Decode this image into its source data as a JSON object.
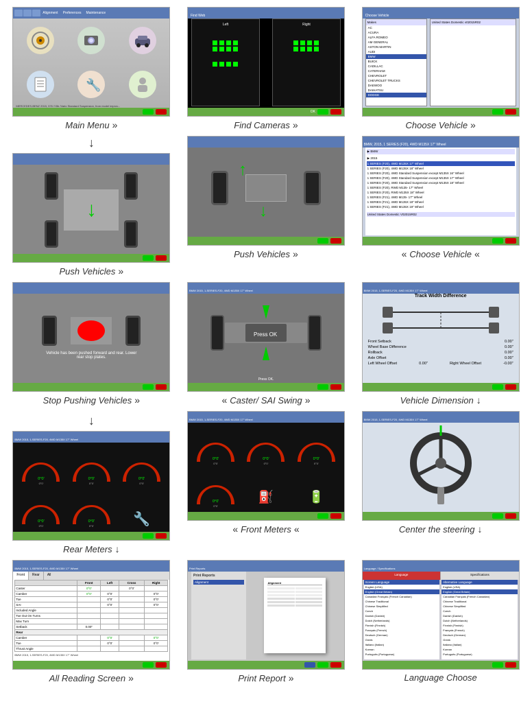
{
  "grid": {
    "cells": [
      {
        "id": "main-menu",
        "label": "Main Menu",
        "arrow": "»",
        "arrowDir": "right"
      },
      {
        "id": "find-cameras",
        "label": "Find Cameras",
        "arrow": "»",
        "arrowDir": "right"
      },
      {
        "id": "choose-vehicle",
        "label": "Choose Vehicle",
        "arrow": "»",
        "arrowDir": "right"
      },
      {
        "id": "push-vehicles-1",
        "label": "Push Vehicles",
        "arrow": "»",
        "arrowDir": "right"
      },
      {
        "id": "push-vehicles-2",
        "label": "Push Vehicles",
        "arrow": "»",
        "arrowDir": "right"
      },
      {
        "id": "choose-vehicle-2",
        "label": "Choose Vehicle",
        "arrow": "«",
        "arrowDir": "left"
      },
      {
        "id": "stop-pushing",
        "label": "Stop Pushing Vehicles",
        "arrow": "»",
        "arrowDir": "right"
      },
      {
        "id": "caster-sai",
        "label": "Caster/ SAI Swing",
        "arrow": "»",
        "arrowDir": "right"
      },
      {
        "id": "vehicle-dimension",
        "label": "Vehicle Dimension",
        "arrow": "↓",
        "arrowDir": "down"
      },
      {
        "id": "rear-meters",
        "label": "Rear Meters",
        "arrow": "↓",
        "arrowDir": "down"
      },
      {
        "id": "front-meters",
        "label": "Front Meters",
        "arrow": "«",
        "arrowDir": "left"
      },
      {
        "id": "center-steering",
        "label": "Center the steering",
        "arrow": "↓",
        "arrowDir": "down"
      },
      {
        "id": "all-reading",
        "label": "All Reading Screen",
        "arrow": "»",
        "arrowDir": "right"
      },
      {
        "id": "print-report",
        "label": "Print Report",
        "arrow": "»",
        "arrowDir": "right"
      },
      {
        "id": "language-choose",
        "label": "Language Choose",
        "arrow": "",
        "arrowDir": "none"
      }
    ],
    "vehicle_list": [
      "AC",
      "ACURA",
      "ALFA ROMEO",
      "AM GENERAL",
      "ASTON MARTIN",
      "AUDI",
      "BMW",
      "BUICK",
      "CADILLAC",
      "CATERHAM",
      "CHEVROLET",
      "CHEVROLET TRUCKS",
      "DAEWOO",
      "DAIHATSU",
      "DODGE"
    ],
    "vehicle_models": [
      "▶ 2015",
      "1 SERIES (F20), 4WD M135X 16\" Wheel",
      "1 SERIES (F20), 4WD M135X 17\" Wheel",
      "1 SERIES (F20), 4WD M135X 18\" Wheel",
      "1 SERIES (F20), 4WD Standard Suspension except M135X 16\" Wheel",
      "1 SERIES (F20), 4WD Standard Suspension except M135X 17\" Wheel",
      "1 SERIES (F20), 4WD Standard Suspension except M135X 18\" Wheel",
      "1 SERIES (F20), RWD M135- 17\" Wheel",
      "1 SERIES (F20), RWD M135X 18\" Wheel",
      "1 SERIES (F21), 4WD M135- 17\" Wheel",
      "1 SERIES (F21), 4WD M135X 18\" Wheel",
      "1 SERIES (F21), 4WD M135X 19\" Wheel"
    ],
    "languages": [
      "English (USA)",
      "English (Great Britain)",
      "Canadian Fraçais (French Canadian)",
      "Chinese Traditional",
      "Chinese Simplified",
      "Czech",
      "Danish (Danish)",
      "Dutch (Netherlands)",
      "Finnish (Finnish)",
      "Français (French)",
      "Deutsch (German)",
      "Greek",
      "Italiano (Italian)",
      "Korean",
      "Português (Portuguese)"
    ],
    "alt_languages": [
      "English (USA)",
      "English (Great Britain)",
      "Canadian Fraçais (French Canadian)",
      "Chinese Traditional",
      "Chinese Simplified",
      "Czech",
      "Danish (Danish)",
      "Dutch (Netherlands)",
      "Finnish (Finnish)",
      "Français (French)",
      "Deutsch (German)",
      "Greek",
      "Italiano (Italian)",
      "Korean",
      "Português (Portuguese)"
    ],
    "dimensions": {
      "front_setback": "0.00\"",
      "wheel_base_diff": "0.00\"",
      "rollback": "0.00\"",
      "left_wheel_offset": "0.00\"",
      "right_wheel_offset": "-0.00\"",
      "axle_offset": "0.00\""
    },
    "reading_headers": [
      "",
      "Front",
      "Left",
      "Cross",
      "Right"
    ],
    "reading_rows": [
      [
        "Caster",
        "0°0'",
        "",
        "0°0'"
      ],
      [
        "Camber",
        "0°0'",
        "0°0'",
        "",
        "0°0'"
      ],
      [
        "Toe",
        "",
        "0°0'",
        "",
        "0°0'"
      ],
      [
        "SAI",
        "",
        "0°0'",
        "",
        "0°0'"
      ],
      [
        "Included Angle",
        "",
        "",
        "",
        ""
      ],
      [
        "Toe Out On Turns",
        "",
        "",
        "",
        ""
      ],
      [
        "Max Turn",
        "",
        "",
        "",
        ""
      ],
      [
        "Setback",
        "0.00\"",
        "",
        "",
        ""
      ]
    ]
  }
}
